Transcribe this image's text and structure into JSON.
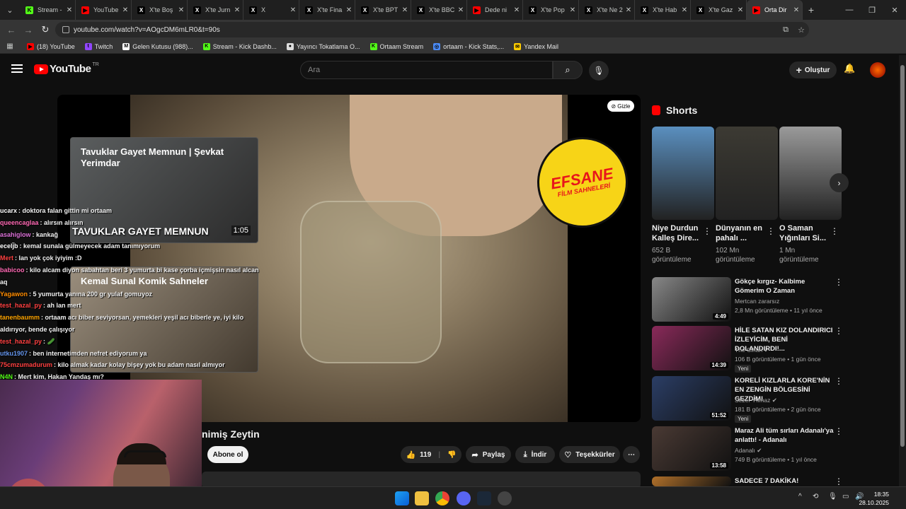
{
  "browser": {
    "tabs": [
      {
        "label": "Stream -",
        "color": "#53fc18",
        "glyph": "K",
        "active": false
      },
      {
        "label": "YouTube",
        "color": "#ff0000",
        "glyph": "▶",
        "active": false
      },
      {
        "label": "X'te Boş",
        "color": "#000000",
        "glyph": "X",
        "active": false
      },
      {
        "label": "X'te Jurn",
        "color": "#000000",
        "glyph": "X",
        "active": false
      },
      {
        "label": "X",
        "color": "#000000",
        "glyph": "X",
        "active": false
      },
      {
        "label": "X'te Fina",
        "color": "#000000",
        "glyph": "X",
        "active": false
      },
      {
        "label": "X'te BPT",
        "color": "#000000",
        "glyph": "X",
        "active": false
      },
      {
        "label": "X'te BBC",
        "color": "#000000",
        "glyph": "X",
        "active": false
      },
      {
        "label": "Dede ni",
        "color": "#ff0000",
        "glyph": "▶",
        "active": false
      },
      {
        "label": "X'te Pop",
        "color": "#000000",
        "glyph": "X",
        "active": false
      },
      {
        "label": "X'te Ne 2",
        "color": "#000000",
        "glyph": "X",
        "active": false
      },
      {
        "label": "X'te Hab",
        "color": "#000000",
        "glyph": "X",
        "active": false
      },
      {
        "label": "X'te Gaz",
        "color": "#000000",
        "glyph": "X",
        "active": false
      },
      {
        "label": "Orta Dir",
        "color": "#ff0000",
        "glyph": "▶",
        "active": true
      }
    ],
    "url": "youtube.com/watch?v=AOgcDM6mLR0&t=90s",
    "bookmarks": [
      {
        "label": "(18) YouTube",
        "color": "#ff0000",
        "glyph": "▶"
      },
      {
        "label": "Twitch",
        "color": "#9146ff",
        "glyph": "t"
      },
      {
        "label": "Gelen Kutusu (988)...",
        "color": "#ffffff",
        "glyph": "M"
      },
      {
        "label": "Stream - Kick Dashb...",
        "color": "#53fc18",
        "glyph": "K"
      },
      {
        "label": "Yayıncı Tokatlama O...",
        "color": "#dddddd",
        "glyph": "●"
      },
      {
        "label": "Ortaam Stream",
        "color": "#53fc18",
        "glyph": "K"
      },
      {
        "label": "ortaam - Kick Stats,...",
        "color": "#4b8bf5",
        "glyph": "◎"
      },
      {
        "label": "Yandex Mail",
        "color": "#ffcc00",
        "glyph": "✉"
      }
    ]
  },
  "youtube": {
    "logo_text": "YouTube",
    "logo_region": "TR",
    "search_placeholder": "Ara",
    "create_label": "Oluştur",
    "gizle_label": "Gizle",
    "badge_line1": "EFSANE",
    "badge_line2": "FİLM SAHNELERİ",
    "video_title": "nimiş Zeytin",
    "subscribe_label": "Abone ol",
    "like_count": "119",
    "share_label": "Paylaş",
    "download_label": "İndir",
    "thanks_label": "Teşekkürler",
    "end_cards": [
      {
        "title": "Tavuklar Gayet Memnun | Şevkat Yerimdar",
        "big": "TAVUKLAR GAYET MEMNUN",
        "duration": "1:05"
      },
      {
        "title": "Kemal Sunal Komik Sahneler",
        "big": "",
        "duration": ""
      }
    ],
    "shorts_label": "Shorts",
    "shorts": [
      {
        "title": "Niye Durdun Kalleş Dire...",
        "views": "652 B",
        "views_suffix": "görüntüleme",
        "color": "#5a8fbf"
      },
      {
        "title": "Dünyanın en pahalı ...",
        "views": "102 Mn",
        "views_suffix": "görüntüleme",
        "color": "#3c3a33"
      },
      {
        "title": "O Saman Yığınları Si...",
        "views": "1 Mn",
        "views_suffix": "görüntüleme",
        "color": "#9a9a9a"
      }
    ],
    "recommendations": [
      {
        "title": "Gökçe kırgız- Kalbime Gömerim O Zaman",
        "channel": "Mertcan zararsız",
        "meta": "2,8 Mn görüntüleme • 11 yıl önce",
        "duration": "4:49",
        "new": "",
        "color": "#888888"
      },
      {
        "title": "HİLE SATAN KIZ DOLANDIRICI İZLEYİCİM, BENİ DOLANDIRDI!...",
        "channel": "The Cihan ✔",
        "meta": "106 B görüntüleme • 1 gün önce",
        "duration": "14:39",
        "new": "Yeni",
        "color": "#8a2a5a"
      },
      {
        "title": "KORELİ KIZLARLA KORE'NİN EN ZENGİN BÖLGESİNİ GEZDİM!",
        "channel": "Sezer Yılmaz ✔",
        "meta": "181 B görüntüleme • 2 gün önce",
        "duration": "51:52",
        "new": "Yeni",
        "color": "#2b3e66"
      },
      {
        "title": "Maraz Ali tüm sırları Adanalı'ya anlattı! - Adanalı",
        "channel": "Adanalı ✔",
        "meta": "749 B görüntüleme • 1 yıl önce",
        "duration": "13:58",
        "new": "",
        "color": "#4a3a34"
      },
      {
        "title": "SADECE 7 DAKİKA!",
        "channel": "",
        "meta": "",
        "duration": "",
        "new": "",
        "color": "#b0702a"
      }
    ]
  },
  "chat": [
    {
      "user": "ucarx",
      "color": "#ffffff",
      "msg": ": doktora falan gittin mi ortaam"
    },
    {
      "user": "queencaglaa",
      "color": "#ff69b4",
      "msg": ": alırsın alırsın"
    },
    {
      "user": "asahiglow",
      "color": "#da70d6",
      "msg": ": kankağ"
    },
    {
      "user": "ecelj̈b",
      "color": "#ffffff",
      "msg": ": kemal sunala gülmeyecek adam tanımıyorum"
    },
    {
      "user": "Mert",
      "color": "#ff4040",
      "msg": ": lan yok çok iyiyim :D"
    },
    {
      "user": "babicoo",
      "color": "#ff69b4",
      "msg": ": kilo alcam diyon sabahtan beri 3 yumurta bi kase çorba içmişsin nasıl alcan aq"
    },
    {
      "user": "Yagawon",
      "color": "#ff8c00",
      "msg": ": 5 yumurta yanına 200 gr yulaf gomuyoz"
    },
    {
      "user": "test_hazal_py",
      "color": "#ff4040",
      "msg": ": ah lan mert"
    },
    {
      "user": "tanenbaumm",
      "color": "#ffa500",
      "msg": ": ortaam acı biber seviyorsan, yemekleri yeşil acı biberle ye, iyi kilo aldırıyor, bende çalışıyor"
    },
    {
      "user": "test_hazal_py",
      "color": "#ff4040",
      "msg": ": 🥒"
    },
    {
      "user": "utku1907",
      "color": "#6495ed",
      "msg": ": ben internetimden nefret ediyorum ya"
    },
    {
      "user": "75cmzumadurum",
      "color": "#ff4040",
      "msg": ": kilo almak kadar kolay bişey yok bu adam nasıl almıyor"
    },
    {
      "user": "N4N",
      "color": "#53fc18",
      "msg": ": Mert kim, Hakan Yandaş mı?"
    }
  ],
  "taskbar": {
    "time": "18:35",
    "date": "28.10.2025"
  }
}
